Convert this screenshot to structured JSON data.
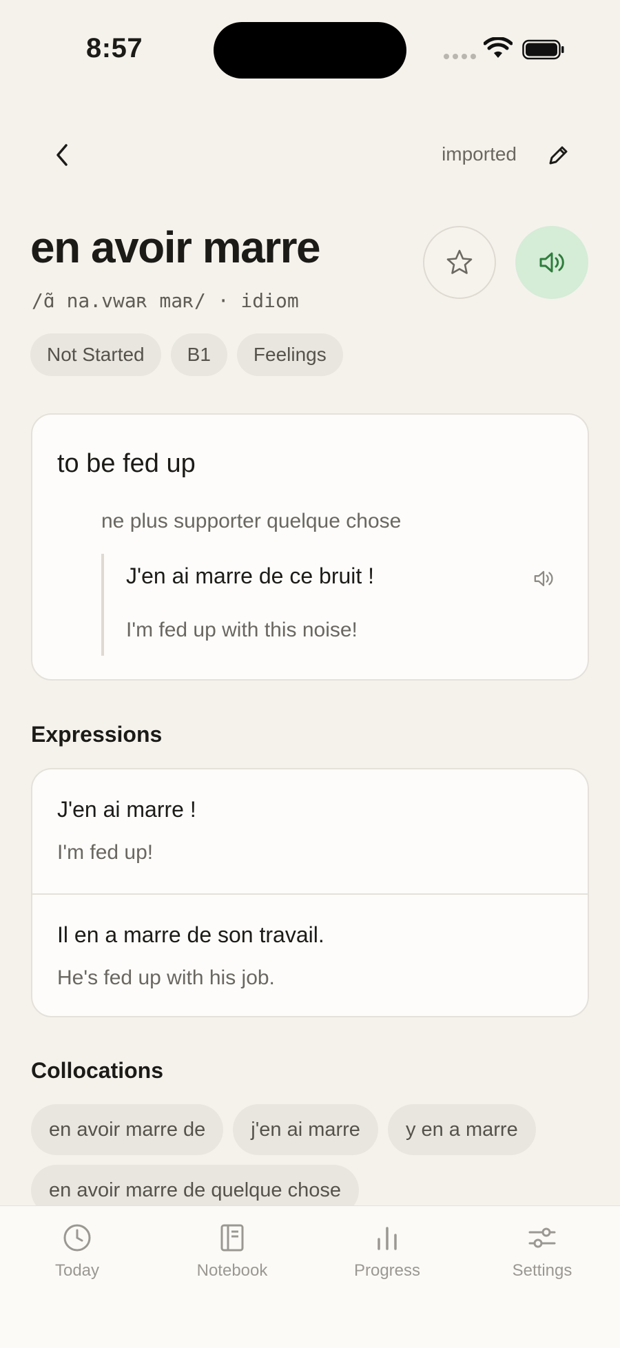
{
  "status_bar": {
    "time": "8:57"
  },
  "nav": {
    "source": "imported"
  },
  "entry": {
    "word": "en avoir marre",
    "meta": "/ɑ̃ na.vwaʀ maʀ/ · idiom",
    "tags": [
      "Not Started",
      "B1",
      "Feelings"
    ]
  },
  "definition": {
    "meaning": "to be fed up",
    "gloss": "ne plus supporter quelque chose",
    "example_fr": "J'en ai marre de ce bruit !",
    "example_en": "I'm fed up with this noise!"
  },
  "expressions": {
    "heading": "Expressions",
    "items": [
      {
        "fr": "J'en ai marre !",
        "en": "I'm fed up!"
      },
      {
        "fr": "Il en a marre de son travail.",
        "en": "He's fed up with his job."
      }
    ]
  },
  "collocations": {
    "heading": "Collocations",
    "items": [
      "en avoir marre de",
      "j'en ai marre",
      "y en a marre",
      "en avoir marre de quelque chose"
    ]
  },
  "tab_bar": {
    "tabs": [
      {
        "label": "Today",
        "icon": "clock-icon"
      },
      {
        "label": "Notebook",
        "icon": "notebook-icon"
      },
      {
        "label": "Progress",
        "icon": "bar-chart-icon"
      },
      {
        "label": "Settings",
        "icon": "sliders-icon"
      }
    ]
  },
  "colors": {
    "background": "#f5f2ec",
    "audio_accent": "#2e7d3c",
    "audio_bg": "#d5ecd7"
  }
}
